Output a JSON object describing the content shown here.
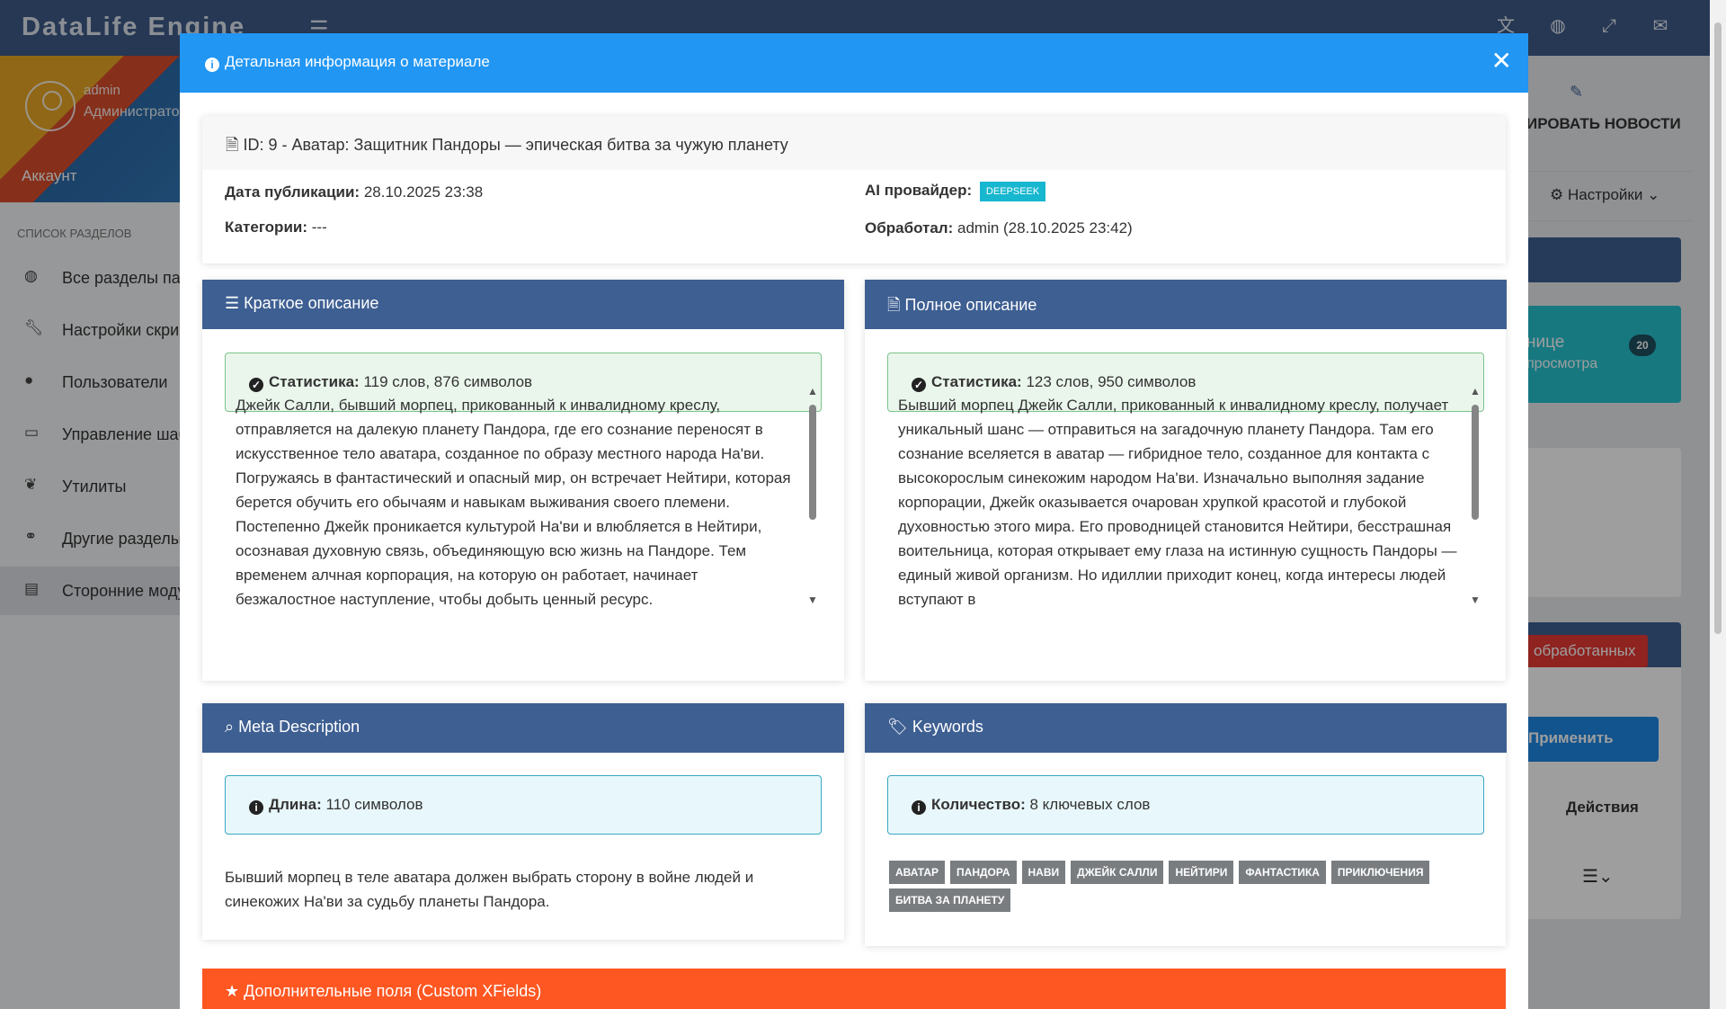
{
  "app": {
    "brand": "DataLife Engine"
  },
  "topbar_icons": [
    "translate-icon",
    "globe-icon",
    "fullscreen-icon",
    "envelope-icon"
  ],
  "profile": {
    "name": "admin",
    "role": "Администратор",
    "account": "Аккаунт"
  },
  "sidebar": {
    "heading": "СПИСОК РАЗДЕЛОВ",
    "items": [
      {
        "label": "Все разделы панели",
        "icon": "globe-icon"
      },
      {
        "label": "Настройки скриптов",
        "icon": "wrench-icon"
      },
      {
        "label": "Пользователи",
        "icon": "user-icon"
      },
      {
        "label": "Управление шаблонами",
        "icon": "laptop-icon"
      },
      {
        "label": "Утилиты",
        "icon": "leaf-icon"
      },
      {
        "label": "Другие разделы",
        "icon": "link-icon"
      },
      {
        "label": "Сторонние модули",
        "icon": "table-icon"
      }
    ]
  },
  "background": {
    "edit_news": "ИРОВАТЬ НОВОСТИ",
    "settings": "Настройки",
    "teal_title": "нице",
    "teal_sub": "просмотра",
    "teal_count": "20",
    "red_button": "обработанных",
    "apply_button": "Применить",
    "actions_label": "Действия"
  },
  "modal": {
    "title": "Детальная информация о материале",
    "material_title": "ID: 9 - Аватар: Защитник Пандоры — эпическая битва за чужую планету",
    "pub_date_label": "Дата публикации:",
    "pub_date": "28.10.2025 23:38",
    "categories_label": "Категории:",
    "categories": "---",
    "ai_label": "AI провайдер:",
    "ai_badge": "DEEPSEEK",
    "processed_label": "Обработал:",
    "processed": "admin (28.10.2025 23:42)",
    "short": {
      "title": "Краткое описание",
      "stat_label": "Статистика:",
      "stat": "119 слов, 876 символов",
      "text": "Джейк Салли, бывший морпец, прикованный к инвалидному креслу, отправляется на далекую планету Пандора, где его сознание переносят в искусственное тело аватара, созданное по образу местного народа На'ви. Погружаясь в фантастический и опасный мир, он встречает Нейтири, которая берется обучить его обычаям и навыкам выживания своего племени. Постепенно Джейк проникается культурой На'ви и влюбляется в Нейтири, осознавая духовную связь, объединяющую всю жизнь на Пандоре. Тем временем алчная корпорация, на которую он работает, начинает безжалостное наступление, чтобы добыть ценный ресурс."
    },
    "full": {
      "title": "Полное описание",
      "stat_label": "Статистика:",
      "stat": "123 слов, 950 символов",
      "text": "Бывший морпец Джейк Салли, прикованный к инвалидному креслу, получает уникальный шанс — отправиться на загадочную планету Пандора. Там его сознание вселяется в аватар — гибридное тело, созданное для контакта с высокорослым синекожим народом На'ви. Изначально выполняя задание корпорации, Джейк оказывается очарован хрупкой красотой и глубокой духовностью этого мира. Его проводницей становится Нейтири, бесстрашная воительница, которая открывает ему глаза на истинную сущность Пандоры — единый живой организм. Но идиллии приходит конец, когда интересы людей вступают в"
    },
    "meta": {
      "title": "Meta Description",
      "len_label": "Длина:",
      "len": "110 символов",
      "text": "Бывший морпец в теле аватара должен выбрать сторону в войне людей и синекожих На'ви за судьбу планеты Пандора."
    },
    "keywords": {
      "title": "Keywords",
      "count_label": "Количество:",
      "count": "8 ключевых слов",
      "tags": [
        "АВАТАР",
        "ПАНДОРА",
        "НАВИ",
        "ДЖЕЙК САЛЛИ",
        "НЕЙТИРИ",
        "ФАНТАСТИКА",
        "ПРИКЛЮЧЕНИЯ",
        "БИТВА ЗА ПЛАНЕТУ"
      ]
    },
    "xfields_title": "Дополнительные поля (Custom XFields)"
  },
  "colors": {
    "header_blue": "#2196f3",
    "panel_navy": "#3e5f92",
    "orange": "#ff5722",
    "teal_badge": "#17b7cf"
  }
}
